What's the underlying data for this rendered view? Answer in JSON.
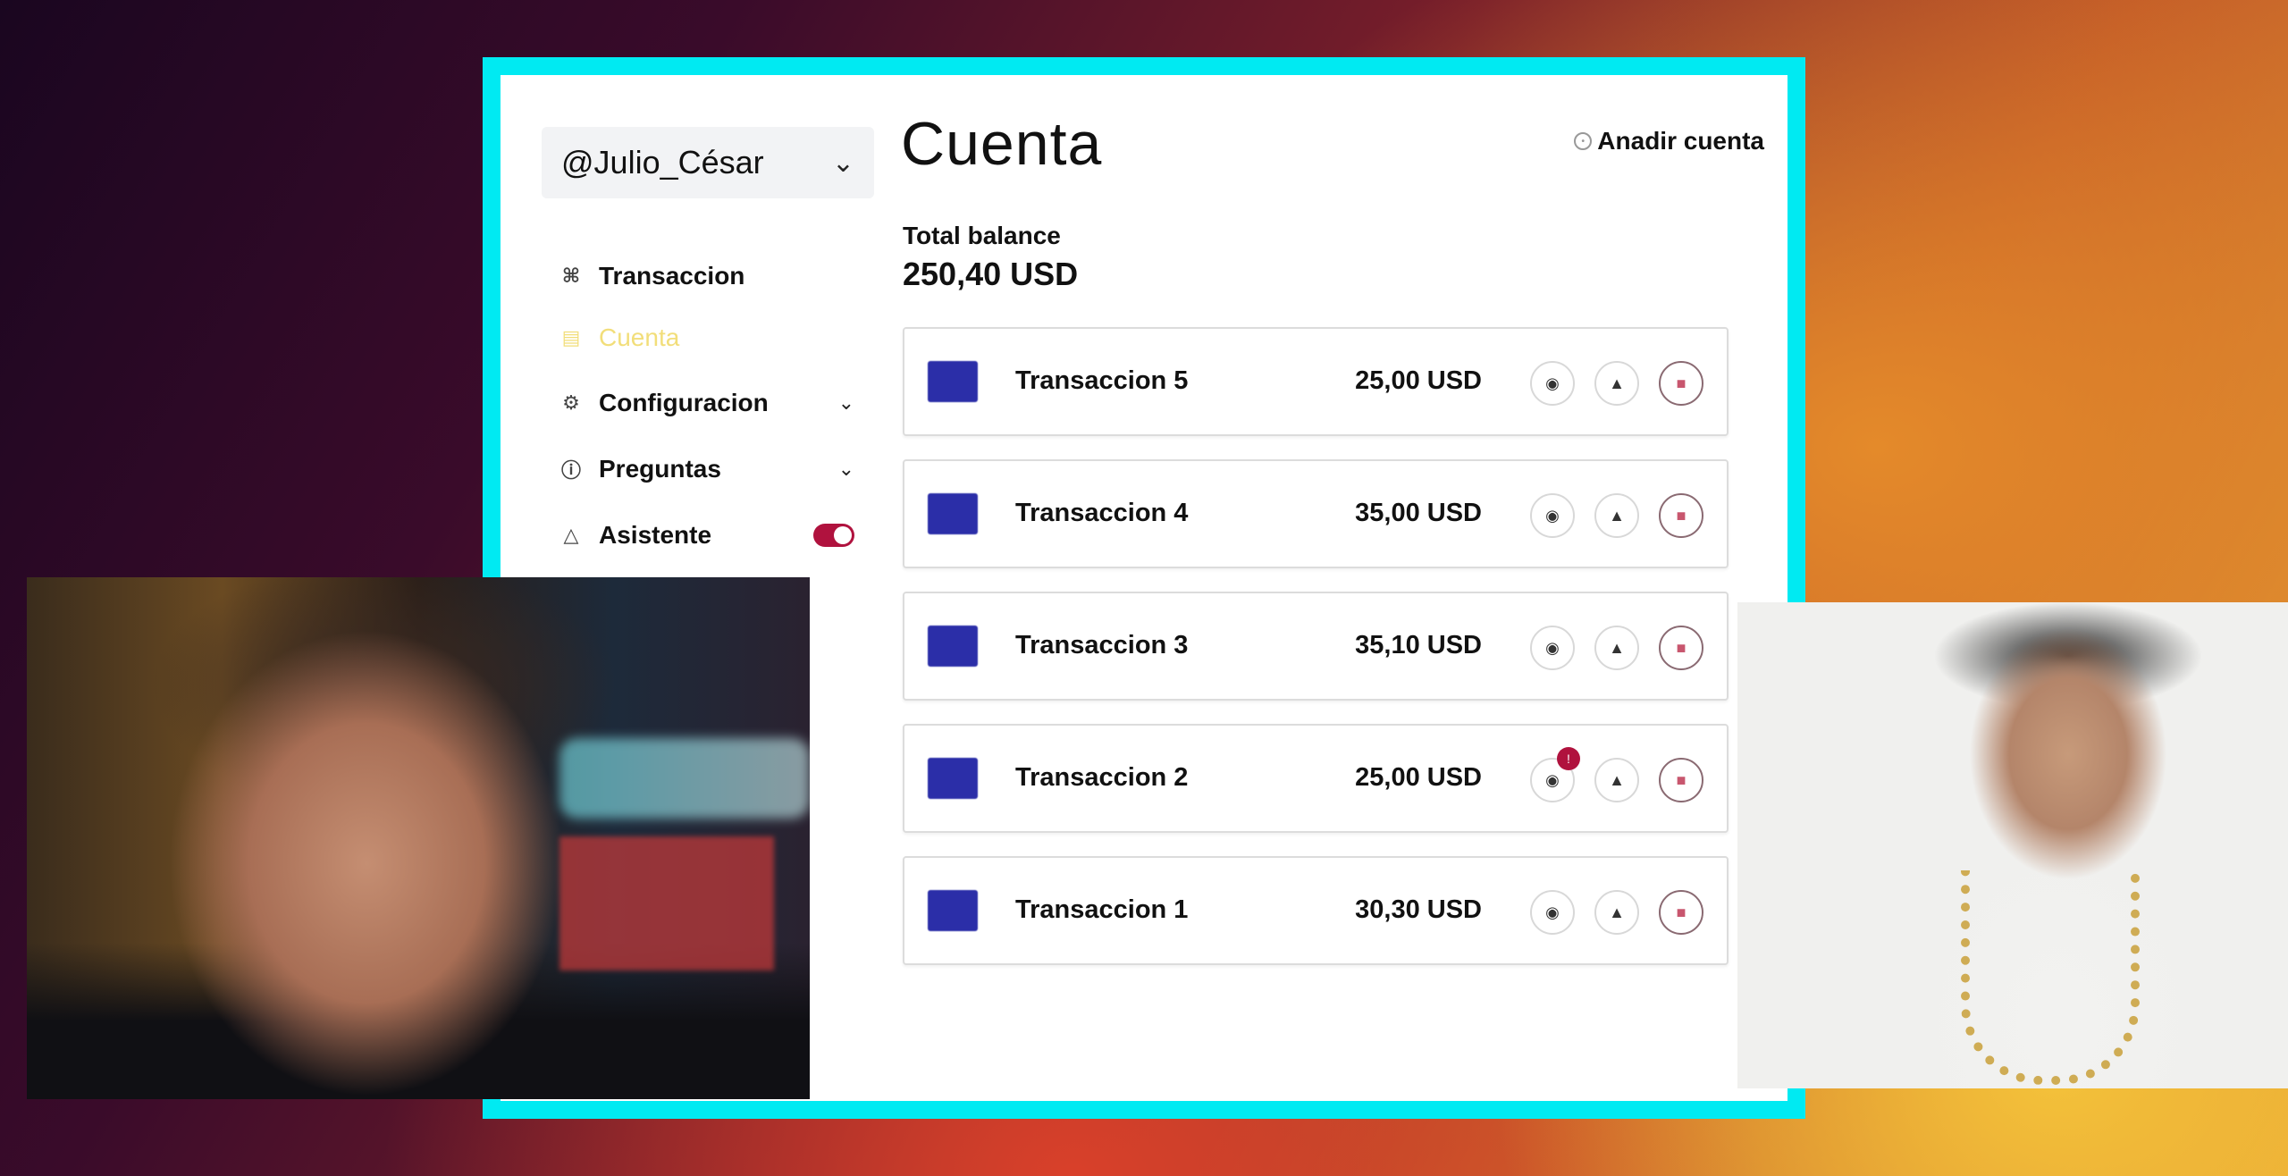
{
  "sidebar": {
    "account": "@Julio_César",
    "items": [
      {
        "label": "Transaccion",
        "icon": "apps-grid-icon"
      },
      {
        "label": "Cuenta",
        "icon": "wallet-icon",
        "active": true
      },
      {
        "label": "Configuracion",
        "icon": "gear-icon"
      },
      {
        "label": "Preguntas",
        "icon": "question-icon"
      },
      {
        "label": "Asistente",
        "icon": "flask-icon",
        "toggle_on": true
      }
    ]
  },
  "main": {
    "title": "Cuenta",
    "add_account": "Anadir cuenta",
    "balance_label": "Total balance",
    "balance_value": "250,40 USD",
    "transactions": [
      {
        "name": "Transaccion 5",
        "amount": "25,00 USD"
      },
      {
        "name": "Transaccion 4",
        "amount": "35,00 USD"
      },
      {
        "name": "Transaccion 3",
        "amount": "35,10 USD"
      },
      {
        "name": "Transaccion 2",
        "amount": "25,00 USD",
        "badge": true
      },
      {
        "name": "Transaccion 1",
        "amount": "30,30 USD"
      }
    ]
  },
  "colors": {
    "frame": "#00eaf2",
    "accent": "#b0123e",
    "active_nav": "#f2de7a",
    "thumb": "#2b2ea8"
  }
}
